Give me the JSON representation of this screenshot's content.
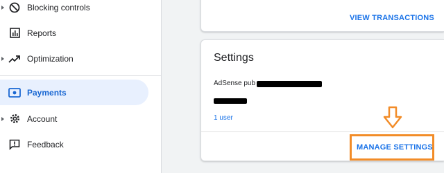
{
  "sidebar": {
    "items": [
      {
        "label": "Blocking controls",
        "icon": "block-icon",
        "has_caret": true,
        "active": false
      },
      {
        "label": "Reports",
        "icon": "reports-icon",
        "has_caret": false,
        "active": false
      },
      {
        "label": "Optimization",
        "icon": "trending-up-icon",
        "has_caret": true,
        "active": false
      },
      {
        "label": "Payments",
        "icon": "payments-icon",
        "has_caret": false,
        "active": true
      },
      {
        "label": "Account",
        "icon": "gear-icon",
        "has_caret": true,
        "active": false
      },
      {
        "label": "Feedback",
        "icon": "feedback-icon",
        "has_caret": false,
        "active": false
      }
    ]
  },
  "transactions_card": {
    "view_transactions_label": "VIEW TRANSACTIONS"
  },
  "settings_card": {
    "title": "Settings",
    "publisher_label": "AdSense pub",
    "users_link": "1 user",
    "manage_settings_label": "MANAGE SETTINGS"
  },
  "colors": {
    "accent": "#1a73e8",
    "active_bg": "#e8f0fe",
    "highlight": "#f28c28"
  }
}
